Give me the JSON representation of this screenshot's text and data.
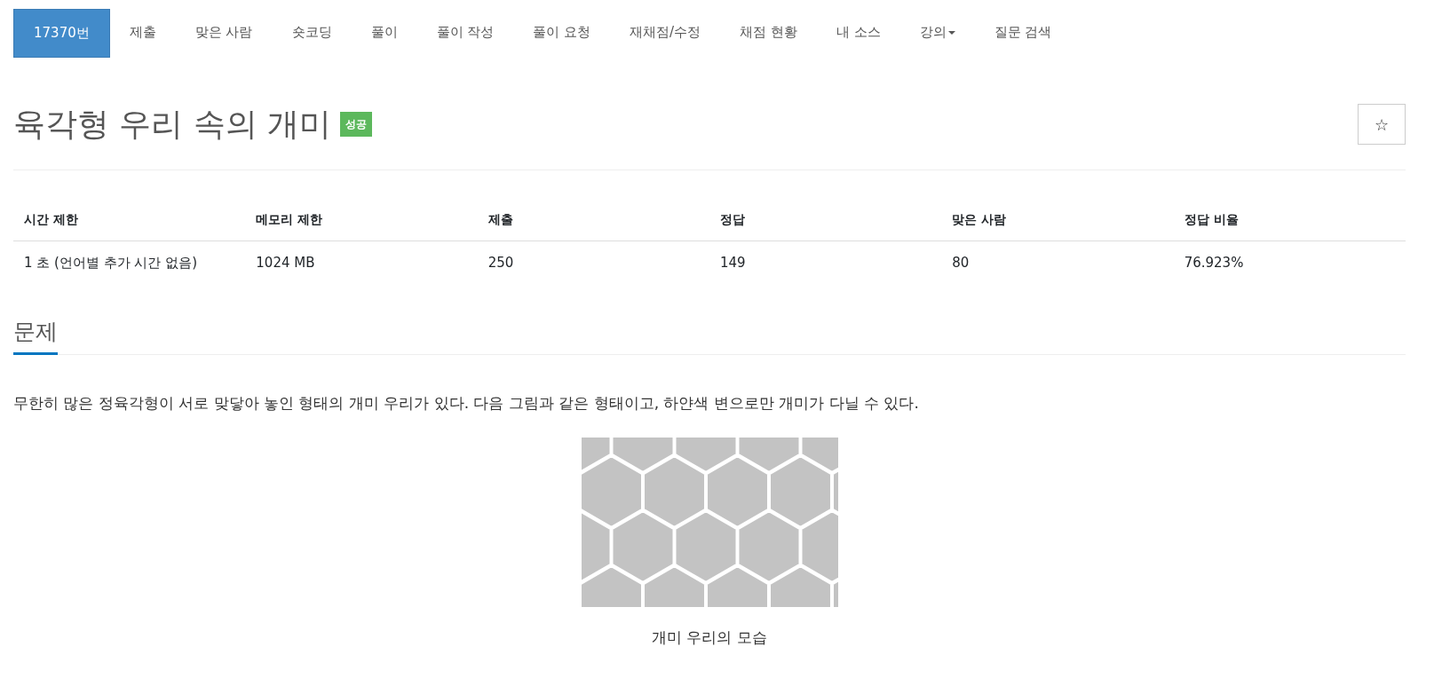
{
  "nav": [
    {
      "label": "17370번",
      "selected": true
    },
    {
      "label": "제출",
      "selected": false
    },
    {
      "label": "맞은 사람",
      "selected": false
    },
    {
      "label": "숏코딩",
      "selected": false
    },
    {
      "label": "풀이",
      "selected": false
    },
    {
      "label": "풀이 작성",
      "selected": false
    },
    {
      "label": "풀이 요청",
      "selected": false
    },
    {
      "label": "재채점/수정",
      "selected": false
    },
    {
      "label": "채점 현황",
      "selected": false
    },
    {
      "label": "내 소스",
      "selected": false
    },
    {
      "label": "강의",
      "selected": false,
      "dropdown": true
    },
    {
      "label": "질문 검색",
      "selected": false
    }
  ],
  "title": "육각형 우리 속의 개미",
  "status_badge": "성공",
  "star_button": "☆",
  "info_table": {
    "columns": [
      "시간 제한",
      "메모리 제한",
      "제출",
      "정답",
      "맞은 사람",
      "정답 비율"
    ],
    "rows": [
      [
        "1 초 (언어별 추가 시간 없음)",
        "1024 MB",
        "250",
        "149",
        "80",
        "76.923%"
      ]
    ]
  },
  "section_heading": "문제",
  "description": "무한히 많은 정육각형이 서로 맞닿아 놓인 형태의 개미 우리가 있다. 다음 그림과 같은 형태이고, 하얀색 변으로만 개미가 다닐 수 있다.",
  "figure": {
    "caption": "개미 우리의 모습"
  }
}
